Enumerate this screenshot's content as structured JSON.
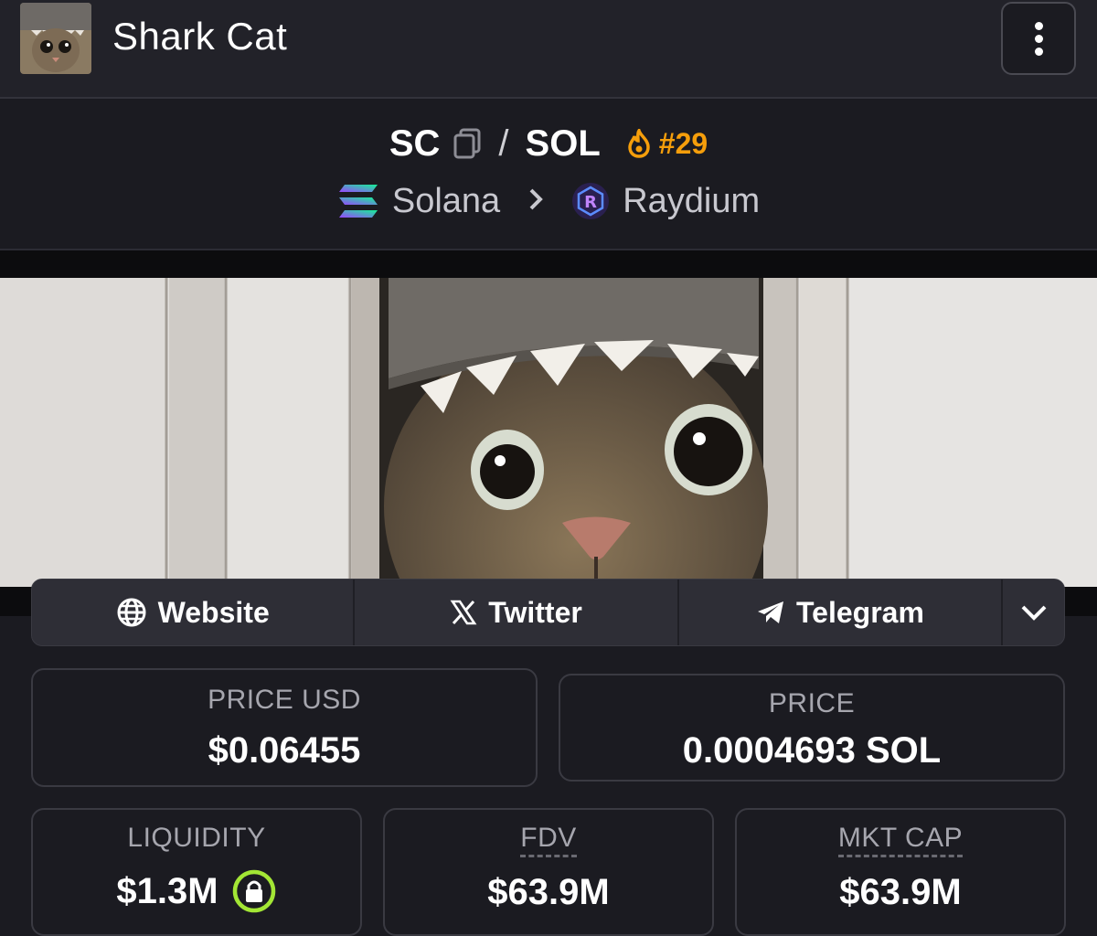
{
  "header": {
    "title": "Shark Cat"
  },
  "pair": {
    "base": "SC",
    "separator": "/",
    "quote": "SOL",
    "rank": "#29",
    "chain": "Solana",
    "dex": "Raydium"
  },
  "links": [
    {
      "label": "Website",
      "icon": "globe-icon"
    },
    {
      "label": "Twitter",
      "icon": "x-icon"
    },
    {
      "label": "Telegram",
      "icon": "telegram-icon"
    }
  ],
  "stats": {
    "price_usd": {
      "label": "PRICE USD",
      "value": "$0.06455"
    },
    "price": {
      "label": "PRICE",
      "value": "0.0004693 SOL"
    },
    "liquidity": {
      "label": "LIQUIDITY",
      "value": "$1.3M"
    },
    "fdv": {
      "label": "FDV",
      "value": "$63.9M"
    },
    "mkt_cap": {
      "label": "MKT CAP",
      "value": "$63.9M"
    }
  },
  "colors": {
    "background": "#1b1b21",
    "accent_orange": "#f59e0b",
    "lock_green": "#a3e635"
  }
}
